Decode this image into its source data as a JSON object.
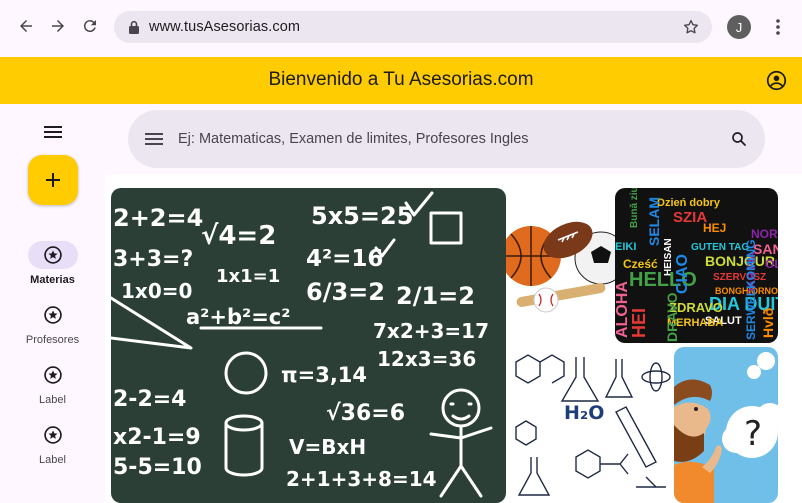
{
  "browser": {
    "url": "www.tusAsesorias.com",
    "profile_initial": "J"
  },
  "app": {
    "title": "Bienvenido a Tu Asesorias.com",
    "brand_color": "#fecc00"
  },
  "search": {
    "placeholder": "Ej: Matematicas, Examen de limites, Profesores Ingles"
  },
  "rail": {
    "items": [
      {
        "label": "Materias",
        "icon": "star-circle-icon",
        "active": true
      },
      {
        "label": "Profesores",
        "icon": "star-circle-icon",
        "active": false
      },
      {
        "label": "Label",
        "icon": "star-circle-icon",
        "active": false
      },
      {
        "label": "Label",
        "icon": "star-circle-icon",
        "active": false
      }
    ]
  },
  "gallery": {
    "chalkboard": [
      "2+2=4",
      "5x5=25",
      "3+3=?",
      "√4=2",
      "4²=16",
      "1x1=1",
      "1x0=0",
      "a²+b²=c²",
      "6/3=2",
      "2/1=2",
      "7x2+3=17",
      "12x3=36",
      "π=3,14",
      "√36=6",
      "2-2=4",
      "x2-1=9",
      "V=BxH",
      "5-5=10",
      "2+1+3+8=14"
    ],
    "word_cloud": [
      "Dzień dobry",
      "SZIA",
      "Bună ziua",
      "SELAM",
      "HEJ",
      "NORO",
      "GUTEN TAG",
      "SAN",
      "BONJOUR",
      "HEISAN",
      "Cześć",
      "SZERVUSZ",
      "HELLO",
      "CIAO",
      "BONGHIORNO",
      "DAR FIA",
      "DIA DUIT",
      "ALOHA",
      "ZDRAVO",
      "SALUT",
      "MERHABA",
      "HEI",
      "DRAVO",
      "SERWELKOMING",
      "Hvlð",
      "OLA",
      "EIKI"
    ],
    "chemistry_label": "H₂O"
  }
}
